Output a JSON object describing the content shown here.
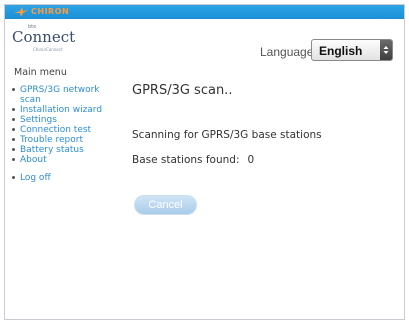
{
  "topbar": {
    "brand": "CHIRON",
    "brand_icon": "bird-icon"
  },
  "logo": {
    "small": "bte",
    "main": "Connect",
    "under": "ChironConnect"
  },
  "language": {
    "label": "Language:",
    "selected": "English"
  },
  "sidebar": {
    "title": "Main menu",
    "items": [
      {
        "label": "GPRS/3G network scan"
      },
      {
        "label": "Installation wizard"
      },
      {
        "label": "Settings"
      },
      {
        "label": "Connection test"
      },
      {
        "label": "Trouble report"
      },
      {
        "label": "Battery status"
      },
      {
        "label": "About"
      }
    ],
    "logoff": "Log off"
  },
  "main": {
    "title": "GPRS/3G scan..",
    "status": "Scanning for GPRS/3G base stations",
    "found_label": "Base stations found:",
    "found_count": "0",
    "cancel_label": "Cancel"
  },
  "colors": {
    "topbar": "#1a8fd6",
    "link": "#2b8fd6",
    "brand": "#ff9a3a",
    "button": "#a9ccea"
  }
}
